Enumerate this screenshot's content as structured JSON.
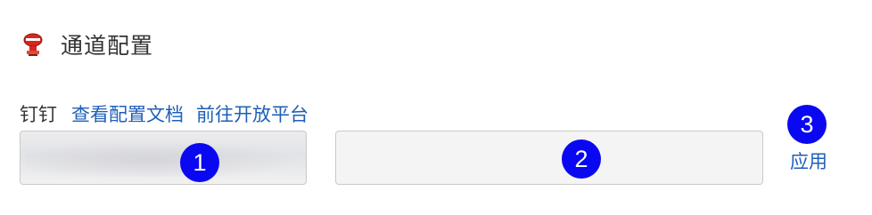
{
  "header": {
    "title": "通道配置",
    "icon": "dingtalk-robot-icon"
  },
  "provider": {
    "name": "钉钉",
    "links": [
      {
        "label": "查看配置文档"
      },
      {
        "label": "前往开放平台"
      }
    ]
  },
  "fields": [
    {
      "value": "",
      "placeholder": ""
    },
    {
      "value": "",
      "placeholder": ""
    }
  ],
  "markers": [
    "1",
    "2",
    "3"
  ],
  "actions": {
    "apply_label": "应用"
  },
  "colors": {
    "link": "#1e5fb8",
    "marker": "#0a08f2",
    "icon_red": "#d9261c"
  }
}
